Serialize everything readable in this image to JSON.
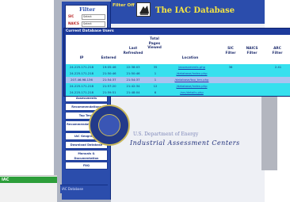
{
  "header": {
    "subtitle": "Filter Off",
    "title": "The IAC Database",
    "logo_icon": "iac-logo-icon"
  },
  "filter": {
    "title": "Filter",
    "rows": [
      {
        "key": "SIC",
        "value": "Select"
      },
      {
        "key": "NAICS",
        "value": "Select"
      },
      {
        "key": "ARC",
        "value": "Select"
      }
    ],
    "clear": "Clear"
  },
  "sidebar": {
    "items": [
      {
        "label": "Main Page"
      },
      {
        "label": "Login/Logout"
      },
      {
        "label": "Industry (SIC)"
      },
      {
        "label": "SIC  NAICS"
      },
      {
        "label": "Glossary of ARCs"
      },
      {
        "label": "Assessments"
      },
      {
        "label": "Recommendations"
      },
      {
        "label": "Top Ten's"
      },
      {
        "label": "Recommendations (RSS)"
      },
      {
        "label": "IAC Geography"
      },
      {
        "label": "Download Database"
      },
      {
        "label": "Manuals & Documentation"
      },
      {
        "label": "FAQ"
      }
    ]
  },
  "popup": {
    "title": "Current Database Users",
    "headers": [
      "IP",
      "Entered",
      "Last Refreshed",
      "Total Pages Viewed",
      "Location",
      "SIC Filter",
      "NAICS Filter",
      "ARC Filter"
    ],
    "rows": [
      {
        "ip": "24.225.171.218",
        "entered": "19:05:46",
        "last": "22:38:03",
        "pages": "35",
        "location": "/assessments.php",
        "sic": "36",
        "naics": "",
        "arc": "2.41"
      },
      {
        "ip": "24.225.171.218",
        "entered": "21:50:46",
        "last": "21:50:46",
        "pages": "1",
        "location": "/database/index.php",
        "sic": "",
        "naics": "",
        "arc": ""
      },
      {
        "ip": "207.46.98.136",
        "entered": "21:54:37",
        "last": "21:54:37",
        "pages": "1",
        "location": "/database/top_ten.php",
        "sic": "",
        "naics": "",
        "arc": ""
      },
      {
        "ip": "24.225.171.218",
        "entered": "21:57:20",
        "last": "21:42:34",
        "pages": "12",
        "location": "/database/index.php",
        "sic": "",
        "naics": "",
        "arc": ""
      },
      {
        "ip": "24.225.171.218",
        "entered": "21:59:51",
        "last": "21:48:04",
        "pages": "6",
        "location": "/arc/details.php",
        "sic": "",
        "naics": "",
        "arc": ""
      }
    ],
    "row_colors": [
      "#36e0ee",
      "#36e0ee",
      "#a9c4f0",
      "#36e0ee",
      "#36e0ee"
    ]
  },
  "seal": {
    "text": "Industrial Assessment Centers",
    "faint_text": "U.S. Department of Energy",
    "seal_icon": "doe-seal-icon"
  },
  "taskbar": {
    "green_label": "IAC",
    "blue_label": "IAC Database"
  }
}
